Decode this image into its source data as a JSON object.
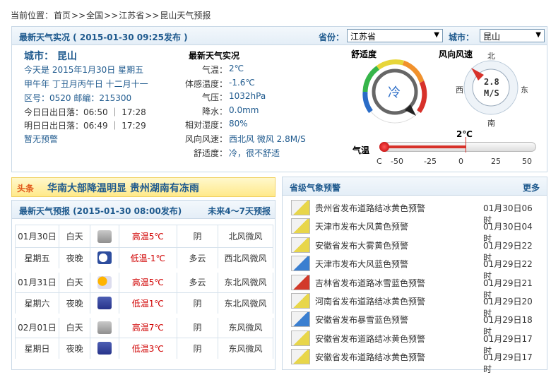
{
  "breadcrumb": {
    "prefix": "当前位置：",
    "home": "首页",
    ">1": ">>",
    "country": "全国",
    ">2": ">>",
    "province": "江苏省",
    ">3": ">>",
    "current": "昆山天气预报"
  },
  "current": {
    "header_title": "最新天气实况 ( 2015-01-30  09:25发布 )",
    "province_label": "省份：",
    "province_value": "江苏省",
    "city_label": "城市：",
    "city_value": "昆山",
    "city_title": "城市：  昆山",
    "date_line": "今天是 2015年1月30日  星期五",
    "lunar_line": "甲午年  丁丑月丙午日  十二月十一",
    "code_line": "区号：0520   邮编：215300",
    "today_sun": "今日日出日落：06:50 ｜ 17:28",
    "tomorrow_sun": "明日日出日落：06:49 ｜ 17:29",
    "no_warning": "暂无预警",
    "obs_title": "最新天气实况",
    "obs": [
      {
        "k": "气温：",
        "v": "2℃"
      },
      {
        "k": "体感温度：",
        "v": "-1.6℃"
      },
      {
        "k": "气压：",
        "v": "1032hPa"
      },
      {
        "k": "降水：",
        "v": "0.0mm"
      },
      {
        "k": "相对湿度：",
        "v": "80%"
      },
      {
        "k": "风向风速：",
        "v": "西北风 微风 2.8M/S"
      },
      {
        "k": "舒适度：",
        "v": "冷，很不舒适"
      }
    ],
    "comfort_title": "舒适度",
    "comfort_value": "冷",
    "wind_title": "风向风速",
    "compass": {
      "n": "北",
      "s": "南",
      "e": "东",
      "w": "西",
      "speed": "2.8",
      "unit": "M/S"
    },
    "temp_label": "气温",
    "temp_value": "2℃",
    "temp_ticks": [
      "C",
      "-50",
      "-25",
      "0",
      "25",
      "50"
    ],
    "temp_range": [
      -50,
      50
    ],
    "temp_reading": 2
  },
  "headline": {
    "tag": "头条",
    "text": "华南大部降温明显  贵州湖南有冻雨"
  },
  "forecast": {
    "title": "最新天气预报 (2015-01-30  08:00发布)",
    "link": "未来4～7天预报",
    "days": [
      {
        "date": "01月30日",
        "week": "星期五",
        "day": {
          "p": "白天",
          "t": "高温5℃",
          "w": "阴",
          "wind": "北风微风",
          "icon": "cloudy-icon"
        },
        "night": {
          "p": "夜晚",
          "t": "低温-1℃",
          "w": "多云",
          "wind": "西北风微风",
          "icon": "moon-cloud-icon"
        }
      },
      {
        "date": "01月31日",
        "week": "星期六",
        "day": {
          "p": "白天",
          "t": "高温5℃",
          "w": "多云",
          "wind": "东北风微风",
          "icon": "sun-cloud-icon"
        },
        "night": {
          "p": "夜晚",
          "t": "低温1℃",
          "w": "阴",
          "wind": "东北风微风",
          "icon": "night-cloudy-icon"
        }
      },
      {
        "date": "02月01日",
        "week": "星期日",
        "day": {
          "p": "白天",
          "t": "高温7℃",
          "w": "阴",
          "wind": "东风微风",
          "icon": "cloudy-icon"
        },
        "night": {
          "p": "夜晚",
          "t": "低温3℃",
          "w": "阴",
          "wind": "东风微风",
          "icon": "night-cloudy-icon"
        }
      }
    ]
  },
  "warnings": {
    "title": "省级气象预警",
    "more": "更多",
    "items": [
      {
        "text": "贵州省发布道路结冰黄色预警",
        "date": "01月30日06时",
        "color": "#e8d64a"
      },
      {
        "text": "天津市发布大风黄色预警",
        "date": "01月30日04时",
        "color": "#e8d64a"
      },
      {
        "text": "安徽省发布大雾黄色预警",
        "date": "01月29日22时",
        "color": "#e8d64a"
      },
      {
        "text": "天津市发布大风蓝色预警",
        "date": "01月29日22时",
        "color": "#3b7fd0"
      },
      {
        "text": "吉林省发布道路冰雪蓝色预警",
        "date": "01月29日21时",
        "color": "#d23a2a"
      },
      {
        "text": "河南省发布道路结冰黄色预警",
        "date": "01月29日20时",
        "color": "#e8d64a"
      },
      {
        "text": "安徽省发布暴雪蓝色预警",
        "date": "01月29日18时",
        "color": "#3b7fd0"
      },
      {
        "text": "安徽省发布道路结冰黄色预警",
        "date": "01月29日17时",
        "color": "#e8d64a"
      },
      {
        "text": "安徽省发布道路结冰黄色预警",
        "date": "01月29日17时",
        "color": "#e8d64a"
      }
    ]
  },
  "colors": {
    "accent": "#1f5a8e",
    "high": "#d00000",
    "border": "#c9d8e6"
  }
}
